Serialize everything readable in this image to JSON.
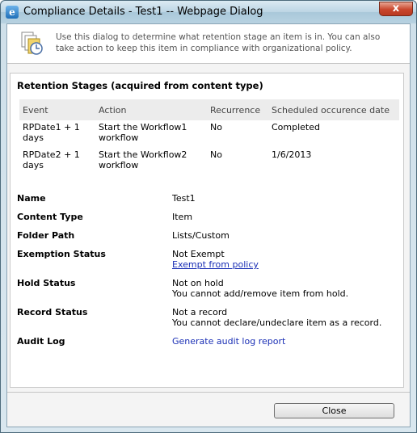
{
  "window": {
    "title": "Compliance Details - Test1 -- Webpage Dialog",
    "close_glyph": "x",
    "ie_glyph": "e"
  },
  "intro": {
    "icon": "compliance-documents-icon",
    "text": "Use this dialog to determine what retention stage an item is in. You can also take action to keep this item in compliance with organizational policy."
  },
  "retention": {
    "heading": "Retention Stages (acquired from content type)",
    "columns": [
      "Event",
      "Action",
      "Recurrence",
      "Scheduled occurence date"
    ],
    "rows": [
      [
        "RPDate1 + 1 days",
        "Start the Workflow1 workflow",
        "No",
        "Completed"
      ],
      [
        "RPDate2 + 1 days",
        "Start the Workflow2 workflow",
        "No",
        "1/6/2013"
      ]
    ]
  },
  "properties": {
    "name_label": "Name",
    "name_value": "Test1",
    "content_type_label": "Content Type",
    "content_type_value": "Item",
    "folder_path_label": "Folder Path",
    "folder_path_value": "Lists/Custom",
    "exemption_label": "Exemption Status",
    "exemption_value": "Not Exempt",
    "exemption_link": "Exempt from policy",
    "hold_label": "Hold Status",
    "hold_value": "Not on hold",
    "hold_note": "You cannot add/remove item from hold.",
    "record_label": "Record Status",
    "record_value": "Not a record",
    "record_note": "You cannot declare/undeclare item as a record.",
    "audit_label": "Audit Log",
    "audit_link": "Generate audit log report"
  },
  "footer": {
    "close_label": "Close"
  },
  "colors": {
    "link": "#1a2fb5",
    "header_bg": "#ececec"
  }
}
